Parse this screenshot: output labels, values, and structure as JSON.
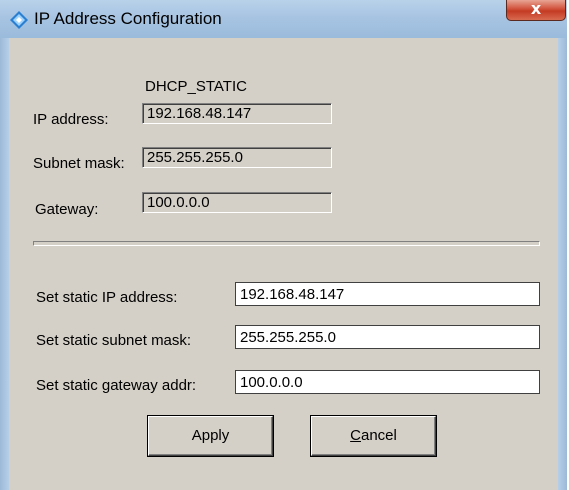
{
  "window": {
    "title": "IP Address Configuration",
    "close_glyph": "x"
  },
  "status": {
    "mode": "DHCP_STATIC",
    "ip_label": "IP address:",
    "ip_value": "192.168.48.147",
    "subnet_label": "Subnet mask:",
    "subnet_value": "255.255.255.0",
    "gateway_label": "Gateway:",
    "gateway_value": "100.0.0.0"
  },
  "static": {
    "ip_label": "Set static IP address:",
    "ip_value": "192.168.48.147",
    "subnet_label": "Set static subnet mask:",
    "subnet_value": "255.255.255.0",
    "gateway_label": "Set static gateway addr:",
    "gateway_value": "100.0.0.0"
  },
  "buttons": {
    "apply_label": "Apply",
    "cancel_label_first": "C",
    "cancel_label_rest": "ancel"
  },
  "colors": {
    "titlebar": "#a7c4e2",
    "dialog_bg": "#d4d0c8",
    "close_button": "#c43a22",
    "app_icon": "#2a7fd0"
  }
}
